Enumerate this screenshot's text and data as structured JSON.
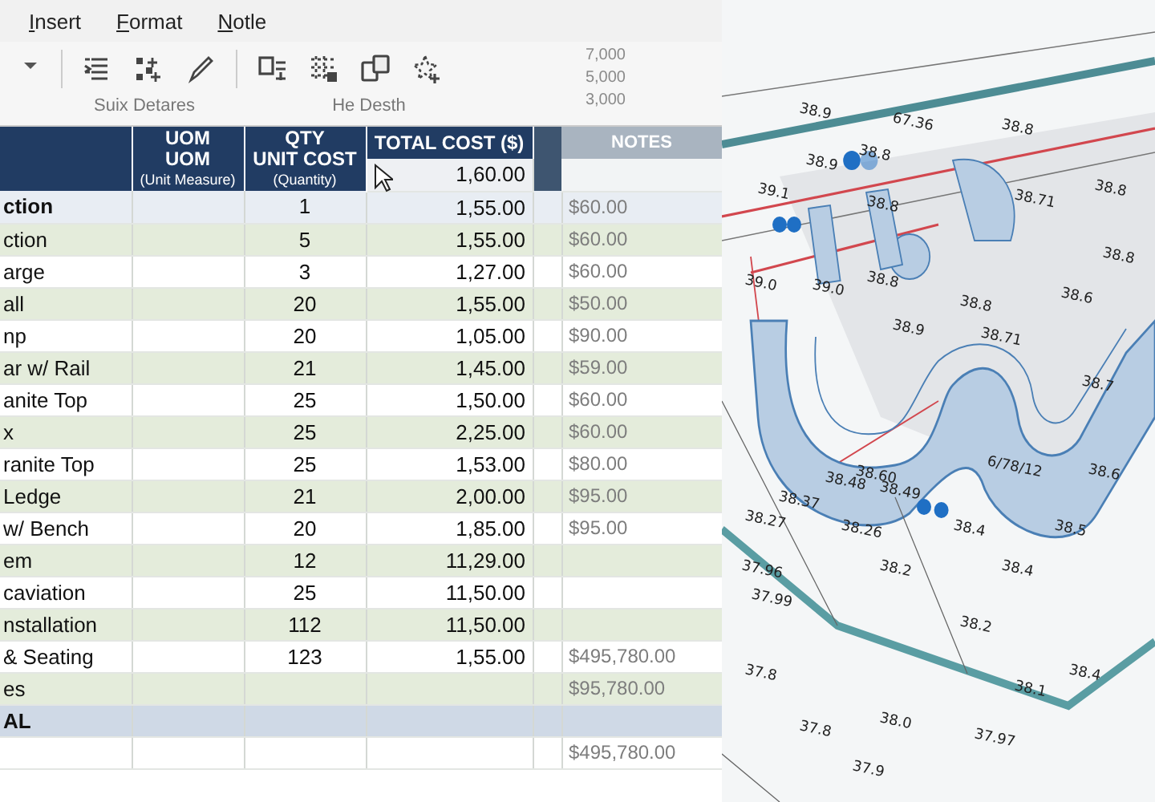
{
  "menu": [
    {
      "label": "Insert"
    },
    {
      "label": "Format"
    },
    {
      "label": "Notle"
    }
  ],
  "ribbon": {
    "groups": [
      {
        "label": "Suix Detares"
      },
      {
        "label": "He Desth"
      }
    ],
    "ghost_values": [
      "7,000",
      "5,000",
      "3,000"
    ]
  },
  "table": {
    "headers": {
      "uom": [
        "UOM",
        "UOM",
        "(Unit Measure)"
      ],
      "qty": [
        "QTY",
        "UNIT COST",
        "(Quantity)"
      ],
      "total": "TOTAL COST ($)",
      "notes": "NOTES"
    },
    "top_value": "1,60.00",
    "rows": [
      {
        "kind": "section",
        "description": "ction",
        "qty": "1",
        "total_cost": "1,55.00",
        "note": "$60.00"
      },
      {
        "kind": "item",
        "description": "ction",
        "qty": "5",
        "total_cost": "1,55.00",
        "note": "$60.00"
      },
      {
        "kind": "item",
        "description": "arge",
        "qty": "3",
        "total_cost": "1,27.00",
        "note": "$60.00"
      },
      {
        "kind": "item",
        "description": "all",
        "qty": "20",
        "total_cost": "1,55.00",
        "note": "$50.00"
      },
      {
        "kind": "item",
        "description": "np",
        "qty": "20",
        "total_cost": "1,05.00",
        "note": "$90.00"
      },
      {
        "kind": "item",
        "description": "ar w/ Rail",
        "qty": "21",
        "total_cost": "1,45.00",
        "note": "$59.00"
      },
      {
        "kind": "item",
        "description": "anite Top",
        "qty": "25",
        "total_cost": "1,50.00",
        "note": "$60.00"
      },
      {
        "kind": "item",
        "description": "x",
        "qty": "25",
        "total_cost": "2,25.00",
        "note": "$60.00"
      },
      {
        "kind": "item",
        "description": "ranite Top",
        "qty": "25",
        "total_cost": "1,53.00",
        "note": "$80.00"
      },
      {
        "kind": "item",
        "description": "Ledge",
        "qty": "21",
        "total_cost": "2,00.00",
        "note": "$95.00"
      },
      {
        "kind": "item",
        "description": "w/ Bench",
        "qty": "20",
        "total_cost": "1,85.00",
        "note": "$95.00"
      },
      {
        "kind": "item",
        "description": "em",
        "qty": "12",
        "total_cost": "11,29.00"
      },
      {
        "kind": "item",
        "description": "caviation",
        "qty": "25",
        "total_cost": "11,50.00"
      },
      {
        "kind": "item",
        "description": "nstallation",
        "qty": "112",
        "total_cost": "11,50.00"
      },
      {
        "kind": "item",
        "description": "& Seating",
        "qty": "123",
        "total_cost": "1,55.00",
        "note": "$495,780.00"
      },
      {
        "kind": "item",
        "description": "es",
        "note": "$95,780.00"
      },
      {
        "kind": "total",
        "description": "AL"
      },
      {
        "kind": "blank",
        "note": "$495,780.00"
      }
    ]
  },
  "site_plan": {
    "labels": [
      "38.9",
      "67.36",
      "38.8",
      "39.1",
      "38.9",
      "38.8",
      "38.8",
      "38.71",
      "38.8",
      "39.0",
      "39.0",
      "38.8",
      "38.9",
      "38.8",
      "38.71",
      "38.6",
      "38.8",
      "38.37",
      "38.48",
      "38.60",
      "38.49",
      "38.27",
      "38.26",
      "37.96",
      "37.99",
      "38.4",
      "38.2",
      "38.4",
      "38.2",
      "38.1",
      "37.97",
      "38.0",
      "37.9",
      "37.8",
      "37.8",
      "6/78/12",
      "38.5",
      "38.7",
      "38.4",
      "38.6"
    ]
  }
}
